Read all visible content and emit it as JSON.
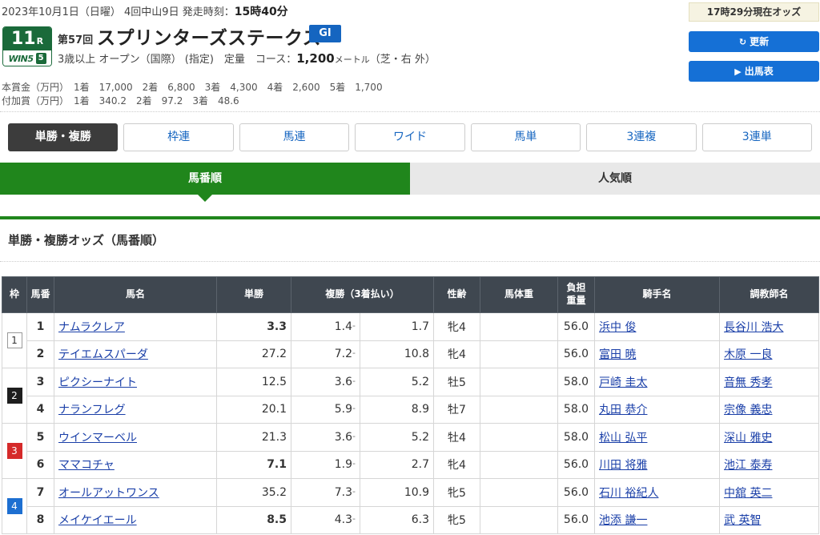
{
  "header": {
    "date_line": "2023年10月1日（日曜） 4回中山9日 発走時刻：",
    "post_time": "15時40分",
    "race_num": "11",
    "race_suffix": "R",
    "win5_logo": "WIN5",
    "win5_leg": "5",
    "edition": "第57回",
    "title": "スプリンターズステークス",
    "grade": "GI",
    "conditions_prefix": "3歳以上 オープン（国際） (指定)　定量　コース：",
    "distance": "1,200",
    "distance_unit": "メートル",
    "track": "（芝・右 外）",
    "prize_main": "本賞金（万円）　1着　17,000　2着　6,800　3着　4,300　4着　2,600　5着　1,700",
    "prize_extra": "付加賞（万円）　1着　340.2　2着　97.2　3着　48.6"
  },
  "side": {
    "odds_time": "17時29分現在オッズ",
    "refresh_label": "更新",
    "refresh_icon": "refresh-icon",
    "entries_label": "出馬表",
    "entries_icon": "play-circle-icon"
  },
  "bet_tabs": [
    "単勝・複勝",
    "枠連",
    "馬連",
    "ワイド",
    "馬単",
    "3連複",
    "3連単"
  ],
  "sort_tabs": [
    "馬番順",
    "人気順"
  ],
  "section_title": "単勝・複勝オッズ（馬番順）",
  "table": {
    "headers": [
      "枠",
      "馬番",
      "馬名",
      "単勝",
      "複勝（3着払い）",
      "性齢",
      "馬体重",
      "負担重量",
      "騎手名",
      "調教師名"
    ],
    "rows": [
      {
        "waku": "1",
        "num": "1",
        "horse": "ナムラクレア",
        "win": "3.3",
        "win_hi": true,
        "place_lo": "1.4",
        "place_hi": "1.7",
        "sex_age": "牝4",
        "body": "",
        "weight": "56.0",
        "jockey": "浜中 俊",
        "trainer": "長谷川 浩大"
      },
      {
        "waku": "",
        "num": "2",
        "horse": "テイエムスパーダ",
        "win": "27.2",
        "win_hi": false,
        "place_lo": "7.2",
        "place_hi": "10.8",
        "sex_age": "牝4",
        "body": "",
        "weight": "56.0",
        "jockey": "富田 暁",
        "trainer": "木原 一良"
      },
      {
        "waku": "2",
        "num": "3",
        "horse": "ピクシーナイト",
        "win": "12.5",
        "win_hi": false,
        "place_lo": "3.6",
        "place_hi": "5.2",
        "sex_age": "牡5",
        "body": "",
        "weight": "58.0",
        "jockey": "戸崎 圭太",
        "trainer": "音無 秀孝"
      },
      {
        "waku": "",
        "num": "4",
        "horse": "ナランフレグ",
        "win": "20.1",
        "win_hi": false,
        "place_lo": "5.9",
        "place_hi": "8.9",
        "sex_age": "牡7",
        "body": "",
        "weight": "58.0",
        "jockey": "丸田 恭介",
        "trainer": "宗像 義忠"
      },
      {
        "waku": "3",
        "num": "5",
        "horse": "ウインマーベル",
        "win": "21.3",
        "win_hi": false,
        "place_lo": "3.6",
        "place_hi": "5.2",
        "sex_age": "牡4",
        "body": "",
        "weight": "58.0",
        "jockey": "松山 弘平",
        "trainer": "深山 雅史"
      },
      {
        "waku": "",
        "num": "6",
        "horse": "ママコチャ",
        "win": "7.1",
        "win_hi": true,
        "place_lo": "1.9",
        "place_hi": "2.7",
        "sex_age": "牝4",
        "body": "",
        "weight": "56.0",
        "jockey": "川田 将雅",
        "trainer": "池江 泰寿"
      },
      {
        "waku": "4",
        "num": "7",
        "horse": "オールアットワンス",
        "win": "35.2",
        "win_hi": false,
        "place_lo": "7.3",
        "place_hi": "10.9",
        "sex_age": "牝5",
        "body": "",
        "weight": "56.0",
        "jockey": "石川 裕紀人",
        "trainer": "中舘 英二"
      },
      {
        "waku": "",
        "num": "8",
        "horse": "メイケイエール",
        "win": "8.5",
        "win_hi": true,
        "place_lo": "4.3",
        "place_hi": "6.3",
        "sex_age": "牝5",
        "body": "",
        "weight": "56.0",
        "jockey": "池添 謙一",
        "trainer": "武 英智"
      }
    ]
  },
  "colors": {
    "accent_green": "#20861c",
    "button_blue": "#1570d6",
    "odds_red": "#b2161f",
    "header_dark": "#3f4750"
  }
}
